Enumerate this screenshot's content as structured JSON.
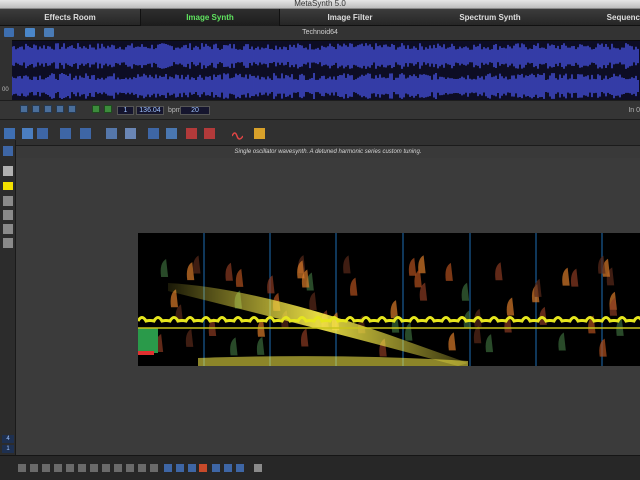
{
  "window": {
    "title": "MetaSynth 5.0"
  },
  "tabs": [
    {
      "label": "Effects Room",
      "active": false
    },
    {
      "label": "Image Synth",
      "active": true
    },
    {
      "label": "Image Filter",
      "active": false
    },
    {
      "label": "Spectrum Synth",
      "active": false
    },
    {
      "label": "Sequenc",
      "active": false
    }
  ],
  "file": {
    "name": "Technoid64"
  },
  "transport": {
    "counter": "1",
    "tempo": "136.04",
    "tempo_unit": "bpm",
    "steps": "20",
    "right_readout": "In 0"
  },
  "left_strip": {
    "wave_label": "00"
  },
  "preset": {
    "description": "Single oscillator wavesynth. A detuned harmonic series custom tuning."
  },
  "bottom": {
    "counter_top": "4",
    "counter_bottom": "1"
  },
  "colors": {
    "active_tab": "#5fe35f",
    "waveform": "#3e48c8",
    "spectrum_line": "#e6e61e",
    "grid_line": "#1e6eb4"
  },
  "icons": {
    "toolbar": [
      "select-icon",
      "layer-icon",
      "grid-icon",
      "grid-icon",
      "pen-icon",
      "spray-icon",
      "grid-icon",
      "hand-icon",
      "faders-icon",
      "faders-icon",
      "wave-icon",
      "brush-icon"
    ],
    "left": [
      "grid-icon",
      "pen-icon",
      "color-swatch-icon",
      "bell-icon",
      "note-icon",
      "note-icon",
      "note-icon"
    ],
    "bottom": [
      "zoom-icon",
      "grid-icon",
      "hand-icon",
      "arrows-icon",
      "play-icon"
    ]
  }
}
